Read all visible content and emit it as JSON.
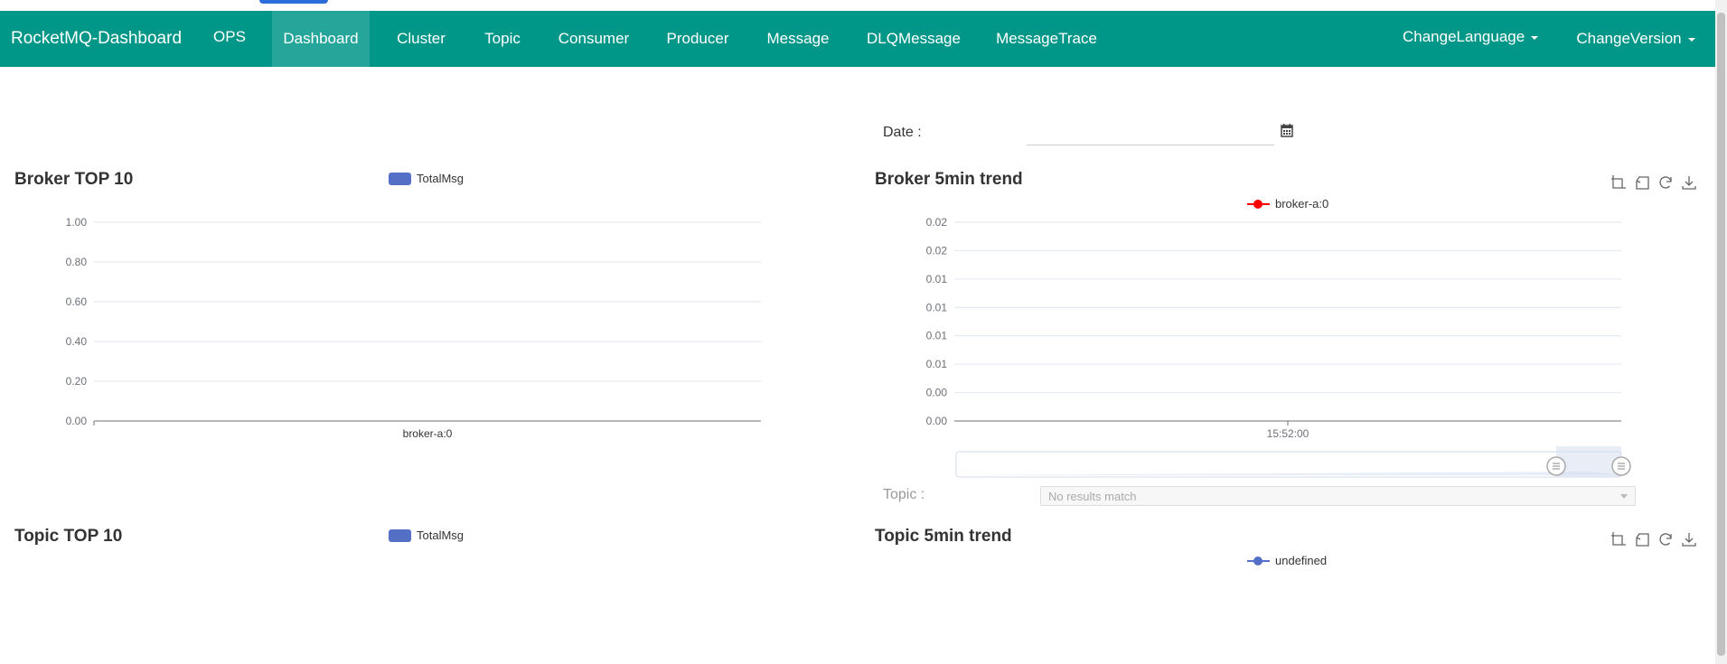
{
  "navbar": {
    "brand": "RocketMQ-Dashboard",
    "items": [
      {
        "label": "OPS"
      },
      {
        "label": "Dashboard",
        "active": true
      },
      {
        "label": "Cluster"
      },
      {
        "label": "Topic"
      },
      {
        "label": "Consumer"
      },
      {
        "label": "Producer"
      },
      {
        "label": "Message"
      },
      {
        "label": "DLQMessage"
      },
      {
        "label": "MessageTrace"
      }
    ],
    "change_language": "ChangeLanguage",
    "change_version": "ChangeVersion",
    "color": "#009688",
    "active_color": "#26a69a"
  },
  "filters": {
    "date_label": "Date :",
    "date_value": "",
    "topic_label": "Topic :",
    "topic_placeholder": "No results match"
  },
  "icons": [
    "calendar-icon",
    "zoom-icon",
    "zoom-reset-icon",
    "restore-icon",
    "download-icon"
  ],
  "panels": {
    "broker_top10": {
      "title": "Broker TOP 10"
    },
    "broker_trend": {
      "title": "Broker 5min trend"
    },
    "topic_top10": {
      "title": "Topic TOP 10"
    },
    "topic_trend": {
      "title": "Topic 5min trend"
    }
  },
  "chart_data": [
    {
      "type": "bar",
      "title": "Broker TOP 10",
      "legend": [
        "TotalMsg"
      ],
      "categories": [
        "broker-a:0"
      ],
      "series": [
        {
          "name": "TotalMsg",
          "values": [
            0
          ],
          "color": "#5470c6"
        }
      ],
      "y_ticks": [
        "0.00",
        "0.20",
        "0.40",
        "0.60",
        "0.80",
        "1.00"
      ],
      "ylim": [
        0,
        1
      ],
      "grid": true
    },
    {
      "type": "line",
      "title": "Broker 5min trend",
      "legend": [
        "broker-a:0"
      ],
      "x": [
        "15:52:00"
      ],
      "series": [
        {
          "name": "broker-a:0",
          "values": [
            0
          ],
          "color": "#ff0000"
        }
      ],
      "y_ticks": [
        "0.00",
        "0.00",
        "0.01",
        "0.01",
        "0.01",
        "0.01",
        "0.02",
        "0.02"
      ],
      "grid": true,
      "datazoom": true
    },
    {
      "type": "bar",
      "title": "Topic TOP 10",
      "legend": [
        "TotalMsg"
      ],
      "categories": [],
      "series": [
        {
          "name": "TotalMsg",
          "values": [],
          "color": "#5470c6"
        }
      ]
    },
    {
      "type": "line",
      "title": "Topic 5min trend",
      "legend": [
        "undefined"
      ],
      "x": [],
      "series": [
        {
          "name": "undefined",
          "values": [],
          "color": "#5470c6"
        }
      ]
    }
  ]
}
